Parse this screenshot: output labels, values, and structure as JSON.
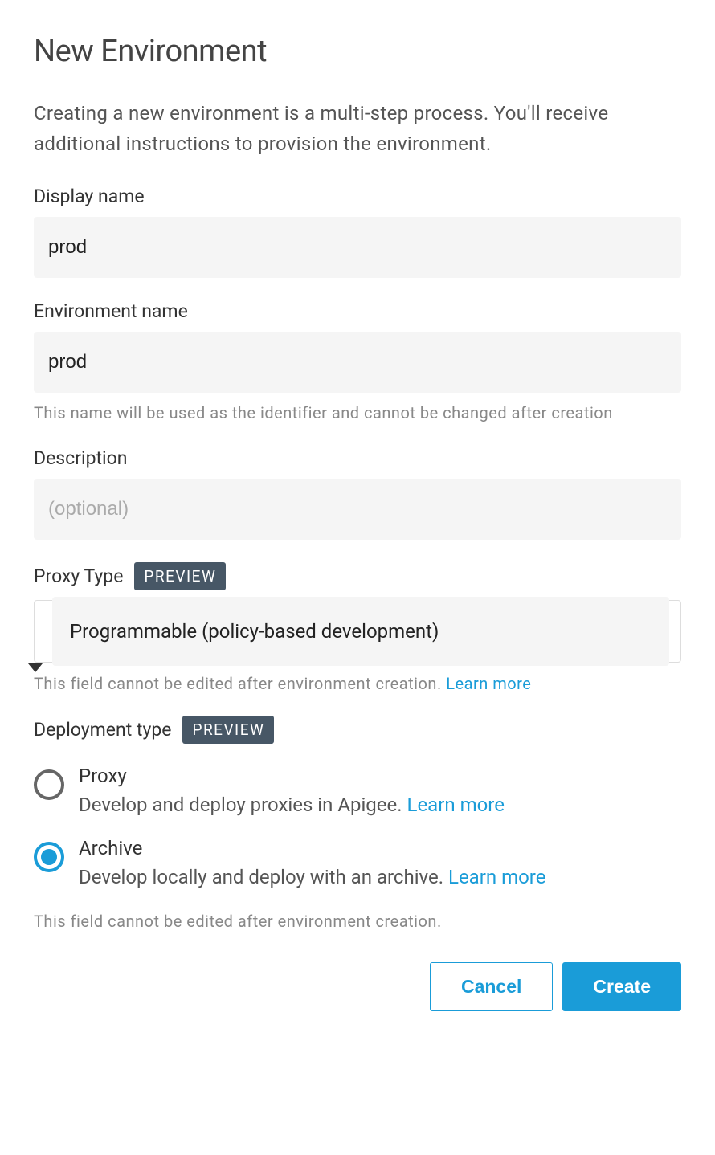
{
  "title": "New Environment",
  "intro": "Creating a new environment is a multi-step process. You'll receive additional instructions to provision the environment.",
  "displayName": {
    "label": "Display name",
    "value": "prod"
  },
  "envName": {
    "label": "Environment name",
    "value": "prod",
    "helper": "This name will be used as the identifier and cannot be changed after creation"
  },
  "description": {
    "label": "Description",
    "placeholder": "(optional)",
    "value": ""
  },
  "proxyType": {
    "label": "Proxy Type",
    "badge": "PREVIEW",
    "selected": "Programmable (policy-based development)",
    "helper": "This field cannot be edited after environment creation. ",
    "learnMore": "Learn more"
  },
  "deploymentType": {
    "label": "Deployment type",
    "badge": "PREVIEW",
    "options": [
      {
        "title": "Proxy",
        "desc": "Develop and deploy proxies in Apigee. ",
        "learnMore": "Learn more",
        "selected": false
      },
      {
        "title": "Archive",
        "desc": "Develop locally and deploy with an archive. ",
        "learnMore": "Learn more",
        "selected": true
      }
    ],
    "helper": "This field cannot be edited after environment creation."
  },
  "buttons": {
    "cancel": "Cancel",
    "create": "Create"
  }
}
